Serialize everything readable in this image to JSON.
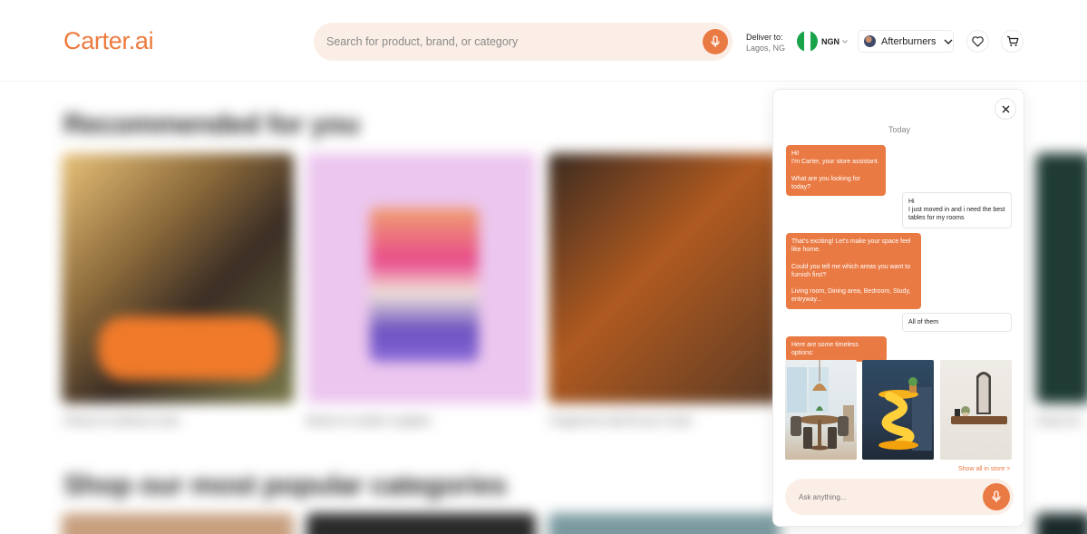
{
  "header": {
    "logo": "Carter.ai",
    "search_placeholder": "Search for product, brand, or category",
    "deliver_label": "Deliver to:",
    "deliver_location": "Lagos, NG",
    "currency": "NGN",
    "account_name": "Afterburners"
  },
  "background": {
    "section1_title": "Recommended for you",
    "section2_title": "Shop our most popular categories",
    "captions": [
      "Fitness & wellness tools",
      "Books & creative supplies",
      "Fragrances that fit your mood",
      "",
      "Smart de"
    ]
  },
  "chat": {
    "day_label": "Today",
    "messages": [
      {
        "from": "bot",
        "text": "Hi!\nI'm Carter, your store assistant.\n\nWhat are you looking for today?"
      },
      {
        "from": "user",
        "text": "Hi\nI just moved in and i need the best tables for my rooms"
      },
      {
        "from": "bot",
        "text": "That's exciting! Let's make your space feel like home.\n\nCould you tell me which areas you want to furnish first?\n\nLiving room, Dining area, Bedroom, Study, entryway..."
      },
      {
        "from": "user",
        "text": "All of them"
      },
      {
        "from": "bot",
        "text": "Here are some timeless options:"
      }
    ],
    "products": [
      "dining-table",
      "glowing-side-table",
      "floating-wall-console"
    ],
    "show_all_label": "Show all in store >",
    "input_placeholder": "Ask anything..."
  },
  "colors": {
    "accent": "#ea7a43",
    "accent_soft": "#fbeee6"
  }
}
